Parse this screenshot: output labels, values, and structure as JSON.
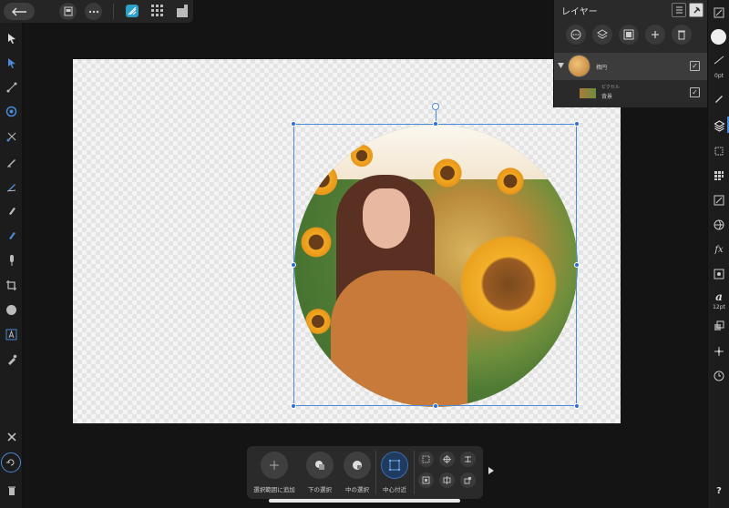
{
  "layers_panel": {
    "title": "レイヤー",
    "layers": [
      {
        "name": "楕円",
        "visible": true,
        "thumb": "photo-circle"
      },
      {
        "type": "ピクセル",
        "name": "背景",
        "visible": true,
        "thumb": "photo-rect"
      }
    ]
  },
  "right_toolbar": {
    "stroke_width": "0pt",
    "font_size": "12pt",
    "help": "?"
  },
  "bottom_toolbar": {
    "items": [
      {
        "label": "選択範囲に追加",
        "icon": "plus-icon"
      },
      {
        "label": "下の選択",
        "icon": "select-below-icon"
      },
      {
        "label": "中の選択",
        "icon": "select-inside-icon"
      },
      {
        "label": "中心付近",
        "icon": "center-icon",
        "active": true
      }
    ]
  },
  "colors": {
    "accent": "#2f6fd0",
    "selection": "#4a8ad8",
    "panel": "#2a2a2a"
  }
}
